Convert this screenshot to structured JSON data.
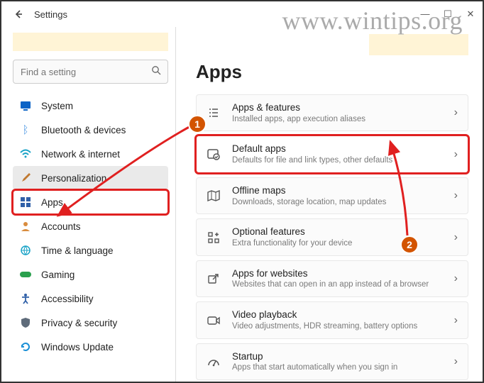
{
  "window": {
    "title": "Settings"
  },
  "search": {
    "placeholder": "Find a setting"
  },
  "sidebar": {
    "items": [
      {
        "label": "System",
        "color": "#0b63c6"
      },
      {
        "label": "Bluetooth & devices",
        "color": "#5aa0e6"
      },
      {
        "label": "Network & internet",
        "color": "#1aa3c7"
      },
      {
        "label": "Personalization",
        "color": "#c07830"
      },
      {
        "label": "Apps",
        "color": "#3060a8"
      },
      {
        "label": "Accounts",
        "color": "#d98c3e"
      },
      {
        "label": "Time & language",
        "color": "#1aa3c7"
      },
      {
        "label": "Gaming",
        "color": "#2aa04d"
      },
      {
        "label": "Accessibility",
        "color": "#3060a8"
      },
      {
        "label": "Privacy & security",
        "color": "#5e6b7a"
      },
      {
        "label": "Windows Update",
        "color": "#1a8fd6"
      }
    ]
  },
  "main": {
    "title": "Apps",
    "cards": [
      {
        "title": "Apps & features",
        "sub": "Installed apps, app execution aliases"
      },
      {
        "title": "Default apps",
        "sub": "Defaults for file and link types, other defaults"
      },
      {
        "title": "Offline maps",
        "sub": "Downloads, storage location, map updates"
      },
      {
        "title": "Optional features",
        "sub": "Extra functionality for your device"
      },
      {
        "title": "Apps for websites",
        "sub": "Websites that can open in an app instead of a browser"
      },
      {
        "title": "Video playback",
        "sub": "Video adjustments, HDR streaming, battery options"
      },
      {
        "title": "Startup",
        "sub": "Apps that start automatically when you sign in"
      }
    ]
  },
  "annotations": {
    "b1": "1",
    "b2": "2"
  },
  "watermark": "www.wintips.org"
}
